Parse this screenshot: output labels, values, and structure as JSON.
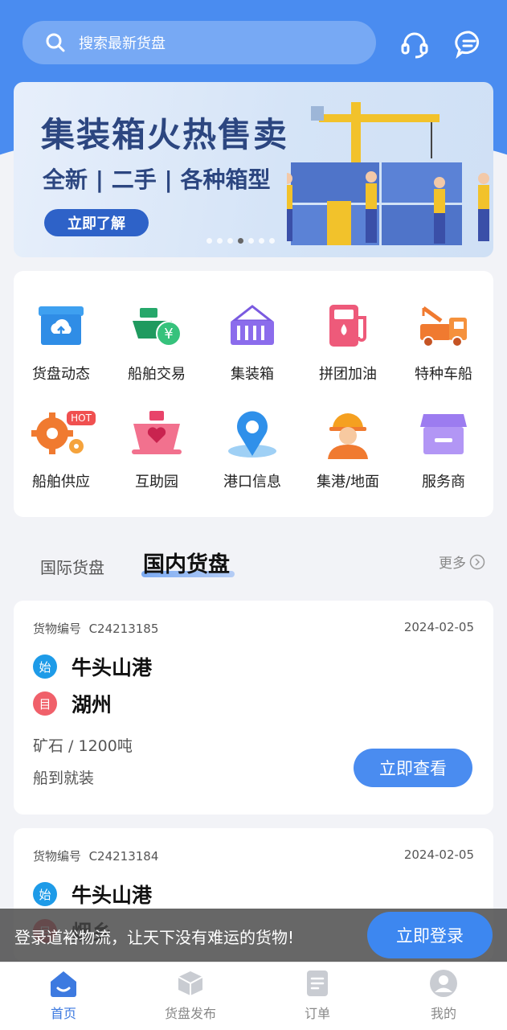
{
  "search": {
    "placeholder": "搜索最新货盘"
  },
  "header": {
    "icons": [
      "headset-icon",
      "chat-icon"
    ]
  },
  "banner": {
    "title": "集装箱火热售卖",
    "subtitle": "全新 | 二手 | 各种箱型",
    "button": "立即了解",
    "dots": 7,
    "active_dot": 4
  },
  "menu": [
    {
      "label": "货盘动态",
      "icon": "cloud-upload-box-icon"
    },
    {
      "label": "船舶交易",
      "icon": "ship-yen-icon"
    },
    {
      "label": "集装箱",
      "icon": "container-icon"
    },
    {
      "label": "拼团加油",
      "icon": "fuel-pump-icon"
    },
    {
      "label": "特种车船",
      "icon": "crane-truck-icon"
    },
    {
      "label": "船舶供应",
      "icon": "gear-hot-icon",
      "badge": "HOT"
    },
    {
      "label": "互助园",
      "icon": "ship-heart-icon"
    },
    {
      "label": "港口信息",
      "icon": "location-pin-icon"
    },
    {
      "label": "集港/地面",
      "icon": "worker-icon"
    },
    {
      "label": "服务商",
      "icon": "shop-icon"
    }
  ],
  "tabs": {
    "inactive": "国际货盘",
    "active": "国内货盘",
    "more": "更多"
  },
  "cards": [
    {
      "no_label": "货物编号",
      "no": "C24213185",
      "date": "2024-02-05",
      "from_badge": "始",
      "from": "牛头山港",
      "to_badge": "目",
      "to": "湖州",
      "goods": "矿石 / 1200吨",
      "load": "船到就装",
      "button": "立即查看"
    },
    {
      "no_label": "货物编号",
      "no": "C24213184",
      "date": "2024-02-05",
      "from_badge": "始",
      "from": "牛头山港",
      "to_badge": "目",
      "to": "烟乡"
    }
  ],
  "login_bar": {
    "text": "登录道裕物流，让天下没有难运的货物!",
    "button": "立即登录"
  },
  "nav": [
    {
      "label": "首页",
      "active": true
    },
    {
      "label": "货盘发布",
      "active": false
    },
    {
      "label": "订单",
      "active": false
    },
    {
      "label": "我的",
      "active": false
    }
  ],
  "colors": {
    "primary": "#4a8cf0",
    "bg": "#f2f3f7",
    "from_badge": "#1e9be8",
    "to_badge": "#f0606a"
  }
}
